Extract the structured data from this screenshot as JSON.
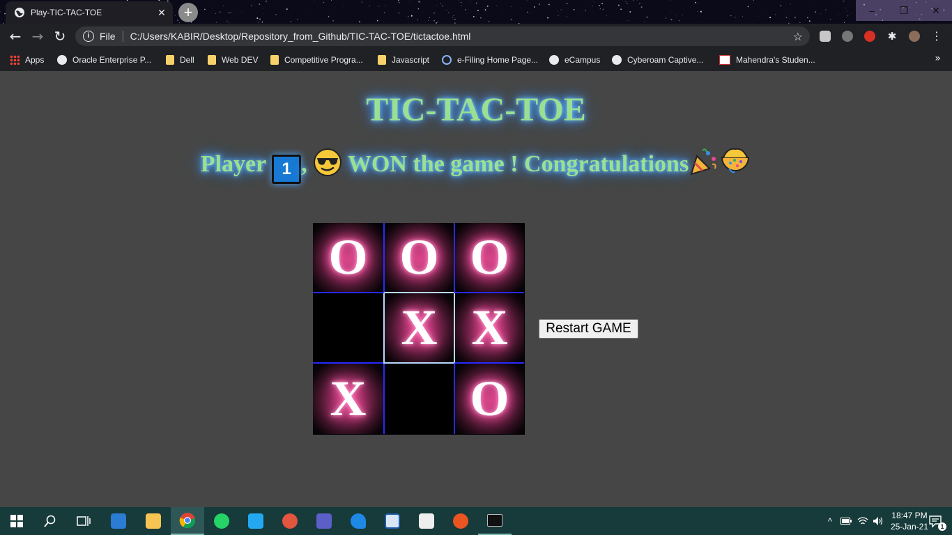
{
  "browser": {
    "tab_title": "Play-TIC-TAC-TOE",
    "tab_close": "✕",
    "new_tab": "+",
    "window_controls": [
      "–",
      "❐",
      "✕"
    ],
    "scheme_label": "File",
    "url": "C:/Users/KABIR/Desktop/Repository_from_Github/TIC-TAC-TOE/tictactoe.html",
    "bookmarks": [
      {
        "label": "Apps",
        "icon": "apps-icon"
      },
      {
        "label": "Oracle Enterprise P...",
        "icon": "globe-icon"
      },
      {
        "label": "Dell",
        "icon": "folder-icon"
      },
      {
        "label": "Web DEV",
        "icon": "folder-icon"
      },
      {
        "label": "Competitive Progra...",
        "icon": "folder-icon"
      },
      {
        "label": "Javascript",
        "icon": "folder-icon"
      },
      {
        "label": "e-Filing Home Page...",
        "icon": "efiling-icon"
      },
      {
        "label": "eCampus",
        "icon": "globe-icon"
      },
      {
        "label": "Cyberoam Captive...",
        "icon": "globe-icon"
      },
      {
        "label": "Mahendra's Studen...",
        "icon": "mahendra-icon"
      }
    ],
    "bookmarks_more": "»"
  },
  "game": {
    "title": "TIC-TAC-TOE",
    "message": {
      "player": "Player",
      "number": "1",
      "comma": ",",
      "rest": "WON the game ! Congratulations"
    },
    "board": [
      [
        "O",
        "O",
        "O"
      ],
      [
        "",
        "X",
        "X"
      ],
      [
        "X",
        "",
        "O"
      ]
    ],
    "restart_label": "Restart GAME"
  },
  "taskbar": {
    "time": "18:47 PM",
    "date": "25-Jan-21",
    "notification_count": "1"
  }
}
